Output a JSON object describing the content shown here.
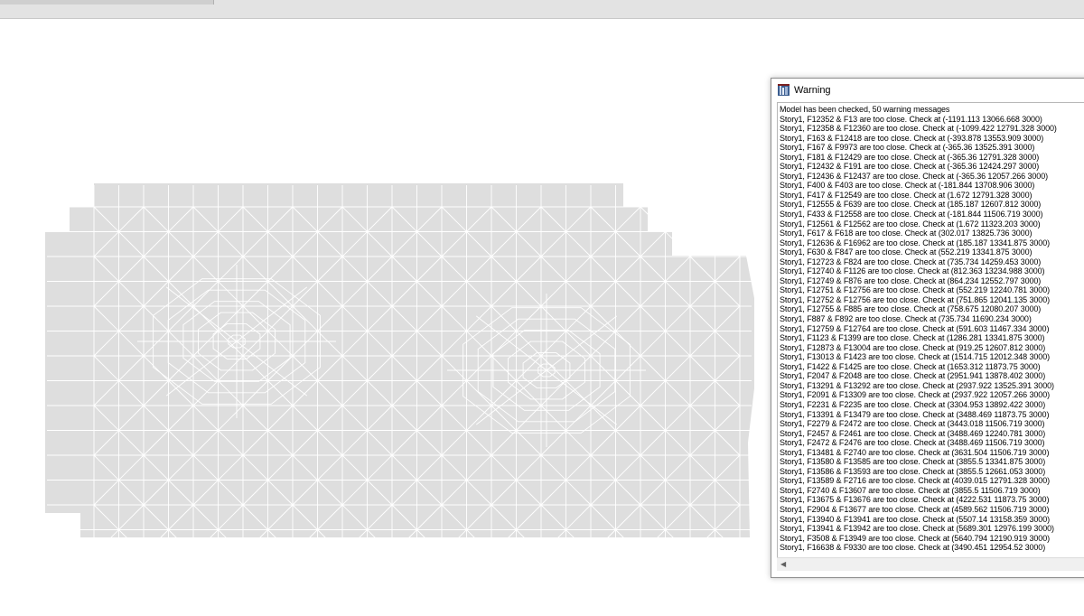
{
  "warning_window": {
    "title": "Warning",
    "summary": "Model has been checked, 50 warning messages",
    "messages": [
      "Story1, F12352 & F13 are too close. Check at (-1191.113 13066.668 3000)",
      "Story1, F12358 & F12360 are too close. Check at (-1099.422 12791.328 3000)",
      "Story1, F163 & F12418 are too close. Check at (-393.878 13553.909 3000)",
      "Story1, F167 & F9973 are too close. Check at (-365.36 13525.391 3000)",
      "Story1, F181 & F12429 are too close. Check at (-365.36 12791.328 3000)",
      "Story1, F12432 & F191 are too close. Check at (-365.36 12424.297 3000)",
      "Story1, F12436 & F12437 are too close. Check at (-365.36 12057.266 3000)",
      "Story1, F400 & F403 are too close. Check at (-181.844 13708.906 3000)",
      "Story1, F417 & F12549 are too close. Check at (1.672 12791.328 3000)",
      "Story1, F12555 & F639 are too close. Check at (185.187 12607.812 3000)",
      "Story1, F433 & F12558 are too close. Check at (-181.844 11506.719 3000)",
      "Story1, F12561 & F12562 are too close. Check at (1.672 11323.203 3000)",
      "Story1, F617 & F618 are too close. Check at (302.017 13825.736 3000)",
      "Story1, F12636 & F16962 are too close. Check at (185.187 13341.875 3000)",
      "Story1, F630 & F847 are too close. Check at (552.219 13341.875 3000)",
      "Story1, F12723 & F824 are too close. Check at (735.734 14259.453 3000)",
      "Story1, F12740 & F1126 are too close. Check at (812.363 13234.988 3000)",
      "Story1, F12749 & F876 are too close. Check at (864.234 12552.797 3000)",
      "Story1, F12751 & F12756 are too close. Check at (552.219 12240.781 3000)",
      "Story1, F12752 & F12756 are too close. Check at (751.865 12041.135 3000)",
      "Story1, F12755 & F885 are too close. Check at (758.675 12080.207 3000)",
      "Story1, F887 & F892 are too close. Check at (735.734 11690.234 3000)",
      "Story1, F12759 & F12764 are too close. Check at (591.603 11467.334 3000)",
      "Story1, F1123 & F1399 are too close. Check at (1286.281 13341.875 3000)",
      "Story1, F12873 & F13004 are too close. Check at (919.25 12607.812 3000)",
      "Story1, F13013 & F1423 are too close. Check at (1514.715 12012.348 3000)",
      "Story1, F1422 & F1425 are too close. Check at (1653.312 11873.75 3000)",
      "Story1, F2047 & F2048 are too close. Check at (2951.941 13878.402 3000)",
      "Story1, F13291 & F13292 are too close. Check at (2937.922 13525.391 3000)",
      "Story1, F2091 & F13309 are too close. Check at (2937.922 12057.266 3000)",
      "Story1, F2231 & F2235 are too close. Check at (3304.953 13892.422 3000)",
      "Story1, F13391 & F13479 are too close. Check at (3488.469 11873.75 3000)",
      "Story1, F2279 & F2472 are too close. Check at (3443.018 11506.719 3000)",
      "Story1, F2457 & F2461 are too close. Check at (3488.469 12240.781 3000)",
      "Story1, F2472 & F2476 are too close. Check at (3488.469 11506.719 3000)",
      "Story1, F13481 & F2740 are too close. Check at (3631.504 11506.719 3000)",
      "Story1, F13580 & F13585 are too close. Check at (3855.5 13341.875 3000)",
      "Story1, F13586 & F13593 are too close. Check at (3855.5 12661.053 3000)",
      "Story1, F13589 & F2716 are too close. Check at (4039.015 12791.328 3000)",
      "Story1, F2740 & F13607 are too close. Check at (3855.5 11506.719 3000)",
      "Story1, F13675 & F13676 are too close. Check at (4222.531 11873.75 3000)",
      "Story1, F2904 & F13677 are too close. Check at (4589.562 11506.719 3000)",
      "Story1, F13940 & F13941 are too close. Check at (5507.14 13158.359 3000)",
      "Story1, F13941 & F13942 are too close. Check at (5689.301 12976.199 3000)",
      "Story1, F3508 & F13949 are too close. Check at (5640.794 12190.919 3000)",
      "Story1, F16638 & F9330 are too close. Check at (3490.451 12954.52 3000)"
    ],
    "scroll_left_glyph": "◀"
  },
  "colors": {
    "mesh_fill": "#dedede",
    "mesh_line": "#ffffff",
    "window_border": "#8e8e8e"
  },
  "icons": {
    "app_icon": "app-icon",
    "scroll_left": "scroll-left-icon"
  }
}
